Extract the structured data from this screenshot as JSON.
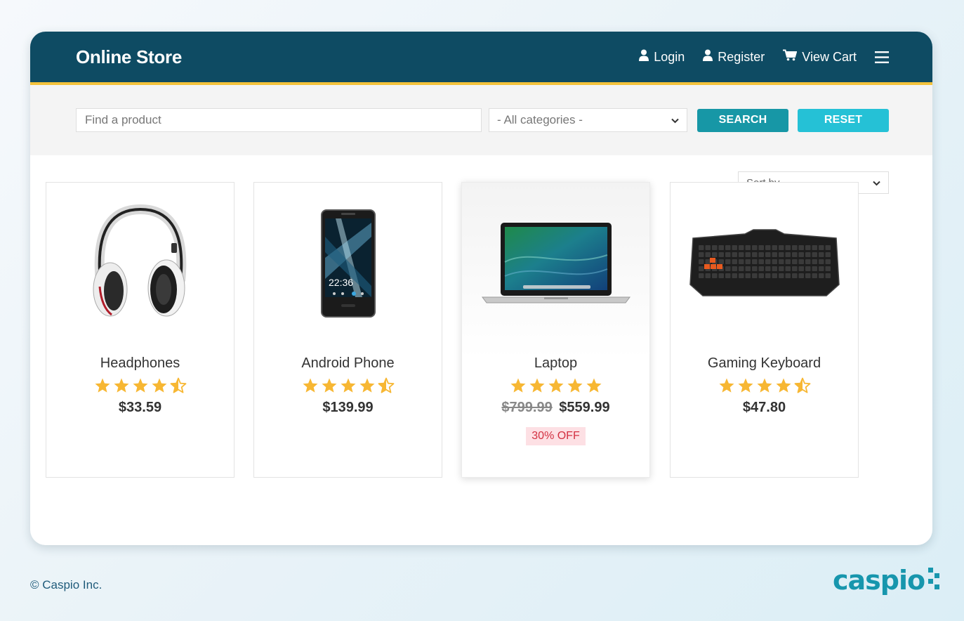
{
  "header": {
    "brand": "Online Store",
    "nav": {
      "login": "Login",
      "register": "Register",
      "cart": "View Cart"
    },
    "menu_icon": "hamburger-icon"
  },
  "search": {
    "placeholder": "Find a product",
    "category_selected": "- All categories -",
    "search_label": "SEARCH",
    "reset_label": "RESET"
  },
  "sort": {
    "selected": "Sort by"
  },
  "products": [
    {
      "name": "Headphones",
      "rating": 4.5,
      "price": "$33.59",
      "image_icon": "headphones"
    },
    {
      "name": "Android Phone",
      "rating": 4.5,
      "price": "$139.99",
      "image_icon": "smartphone",
      "phone_time": "22:36"
    },
    {
      "name": "Laptop",
      "rating": 5,
      "old_price": "$799.99",
      "price": "$559.99",
      "discount": "30% OFF",
      "image_icon": "laptop"
    },
    {
      "name": "Gaming Keyboard",
      "rating": 4.5,
      "price": "$47.80",
      "image_icon": "keyboard"
    }
  ],
  "footer": {
    "copyright": "© Caspio Inc.",
    "logo_text": "caspio"
  },
  "colors": {
    "header_bg": "#0e4b63",
    "header_accent": "#f4c23b",
    "search_button": "#1797a6",
    "reset_button": "#25c1d6",
    "star": "#f7b733",
    "discount_bg": "#fde0e4",
    "discount_text": "#d33142",
    "logo": "#1796ad"
  }
}
